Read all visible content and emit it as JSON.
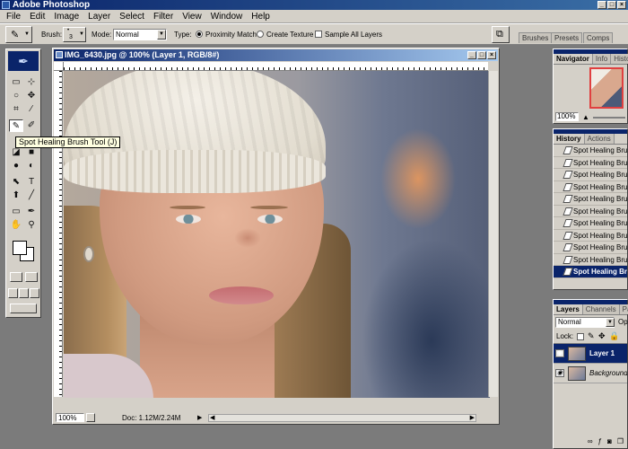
{
  "window": {
    "title": "Adobe Photoshop"
  },
  "menu": [
    "File",
    "Edit",
    "Image",
    "Layer",
    "Select",
    "Filter",
    "View",
    "Window",
    "Help"
  ],
  "options": {
    "brush_label": "Brush:",
    "brush_size": "3",
    "mode_label": "Mode:",
    "mode_value": "Normal",
    "type_label": "Type:",
    "proximity_match": "Proximity Match",
    "create_texture": "Create Texture",
    "sample_all_layers": "Sample All Layers",
    "well_tabs": [
      "Brushes",
      "Presets",
      "Comps"
    ]
  },
  "toolbox": {
    "tooltip": "Spot Healing Brush Tool (J)",
    "tools": [
      "▭",
      "⊹",
      "○",
      "✥",
      "⌒",
      "⁂",
      "⌗",
      "∕",
      "✎",
      "⌖",
      "✐",
      "⌇",
      "◪",
      "■",
      "●",
      "◐",
      "⬉",
      "T",
      "⬆",
      "╱",
      "▭",
      "✒",
      "✋",
      "⚲"
    ]
  },
  "document": {
    "title": "IMG_6430.jpg @ 100% (Layer 1, RGB/8#)",
    "zoom": "100%",
    "doc_info": "Doc: 1.12M/2.24M"
  },
  "navigator": {
    "tabs": [
      "Navigator",
      "Info",
      "Histo"
    ],
    "zoom": "100%"
  },
  "history": {
    "tabs": [
      "History",
      "Actions"
    ],
    "items": [
      "Spot Healing Brush",
      "Spot Healing Brush",
      "Spot Healing Brush",
      "Spot Healing Brush",
      "Spot Healing Brush",
      "Spot Healing Brush",
      "Spot Healing Brush",
      "Spot Healing Brush",
      "Spot Healing Brush",
      "Spot Healing Brush",
      "Spot Healing Brush"
    ],
    "active_index": 10
  },
  "layers": {
    "tabs": [
      "Layers",
      "Channels",
      "Pa"
    ],
    "blend_mode": "Normal",
    "opacity_label": "Op",
    "lock_label": "Lock:",
    "items": [
      "Layer 1",
      "Background"
    ],
    "active_index": 0
  }
}
